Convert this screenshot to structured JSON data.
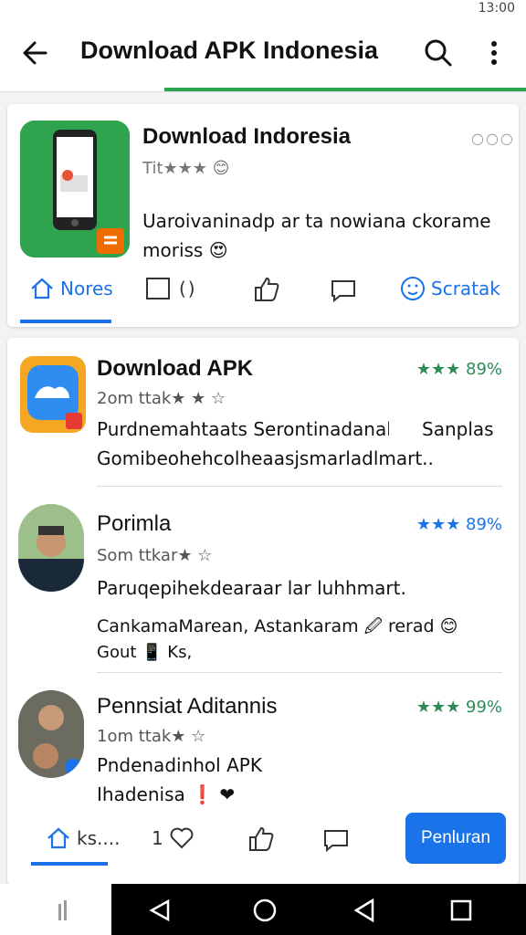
{
  "status_bar": {
    "time": "13:00"
  },
  "app_bar": {
    "title": "Download APK Indonesia"
  },
  "featured": {
    "name": "Download Indoresia",
    "meta": "Tit★★★ 😊",
    "desc_line1": "Uaroivaninadp ar ta nowiana ckorame",
    "desc_line2": "moriss 😍",
    "actions": {
      "more": "Nores",
      "count": "( )",
      "share": "Scratak"
    }
  },
  "list": [
    {
      "title": "Download APK",
      "rating": "★★★ 89%",
      "sub": "2om ttak★ ★ ☆",
      "line1": "Purdnemahtaats Serontinadanal",
      "line1b": "Sanplas",
      "line2": "Gomibeohehcolheaasjsmarladlmart.."
    },
    {
      "title": "Porimla",
      "rating": "★★★ 89%",
      "sub": "Som ttkar★ ☆",
      "line1": "Paruqepihekdearaar lar luhhmart.",
      "line2": "CankamaMarean, Astankaram 🖉 rerad 😊",
      "line3": "Gout 📱 Ks,"
    },
    {
      "title": "Pennsiat Aditannis",
      "rating": "★★★ 99%",
      "sub": "1om ttak★ ☆",
      "line1": "Pndenadinhol APK",
      "line2": "Ihadenisa ❗ ❤"
    }
  ],
  "bottom_actions": {
    "share": "ks....",
    "count": "1",
    "cta": "Penluran"
  },
  "colors": {
    "accent": "#1a73e8",
    "green": "#2ea44f"
  }
}
